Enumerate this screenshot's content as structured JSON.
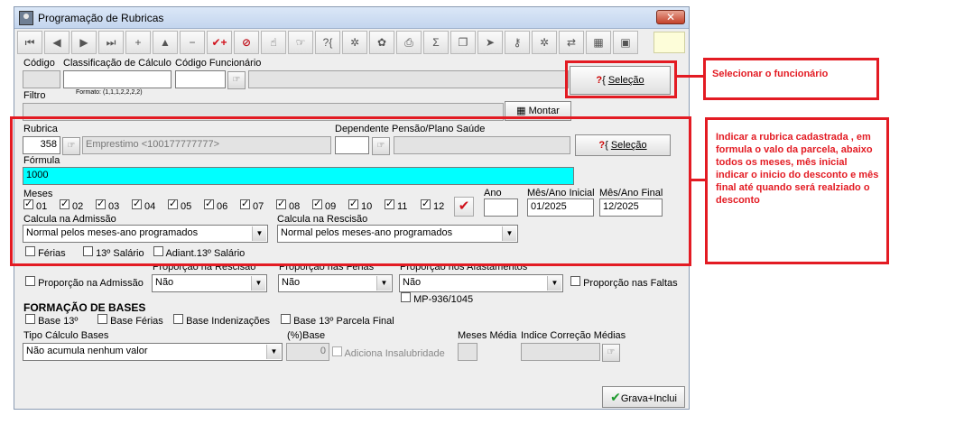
{
  "window": {
    "title": "Programação de Rubricas",
    "close_glyph": "✕"
  },
  "toolbar": {
    "buttons": [
      {
        "name": "first-record-icon",
        "glyph": "⏮"
      },
      {
        "name": "prev-record-icon",
        "glyph": "◀"
      },
      {
        "name": "next-record-icon",
        "glyph": "▶"
      },
      {
        "name": "last-record-icon",
        "glyph": "⏭"
      },
      {
        "name": "add-icon",
        "glyph": "+"
      },
      {
        "name": "edit-up-icon",
        "glyph": "▲"
      },
      {
        "name": "delete-icon",
        "glyph": "−"
      },
      {
        "name": "confirm-icon",
        "glyph": "✔+"
      },
      {
        "name": "cancel-icon",
        "glyph": "⊘"
      },
      {
        "name": "hand-icon",
        "glyph": "☝"
      },
      {
        "name": "select-icon",
        "glyph": "☞"
      },
      {
        "name": "query-icon",
        "glyph": "?{"
      },
      {
        "name": "tools-icon",
        "glyph": "✲"
      },
      {
        "name": "filter-icon",
        "glyph": "✿"
      },
      {
        "name": "print-icon",
        "glyph": "⎙"
      },
      {
        "name": "sum-icon",
        "glyph": "Σ"
      },
      {
        "name": "copy-icon",
        "glyph": "❐"
      },
      {
        "name": "export-icon",
        "glyph": "➤"
      },
      {
        "name": "key-icon",
        "glyph": "⚷"
      },
      {
        "name": "config-icon",
        "glyph": "✲"
      },
      {
        "name": "transfer-icon",
        "glyph": "⇄"
      },
      {
        "name": "calc-icon",
        "glyph": "▦"
      },
      {
        "name": "stop-icon",
        "glyph": "▣"
      }
    ]
  },
  "header": {
    "codigo_label": "Código",
    "classificacao_label": "Classificação de Cálculo",
    "classificacao_format": "Formato: (1,1,1,2,2,2,2)",
    "codigo_func_label": "Código Funcionário",
    "selecao_button": "Seleção",
    "filtro_label": "Filtro",
    "montar_button": "Montar"
  },
  "rubrica": {
    "label": "Rubrica",
    "code": "358",
    "description": "Emprestimo <100177777777>",
    "dependente_label": "Dependente Pensão/Plano Saúde",
    "selecao_button": "Seleção",
    "formula_label": "Fórmula",
    "formula_value": "1000"
  },
  "meses": {
    "label": "Meses",
    "months": [
      "01",
      "02",
      "03",
      "04",
      "05",
      "06",
      "07",
      "08",
      "09",
      "10",
      "11",
      "12"
    ],
    "ano_label": "Ano",
    "mes_ano_inicial_label": "Mês/Ano Inicial",
    "mes_ano_inicial_value": "01/2025",
    "mes_ano_final_label": "Mês/Ano Final",
    "mes_ano_final_value": "12/2025"
  },
  "calcula": {
    "admissao_label": "Calcula na Admissão",
    "admissao_value": "Normal pelos meses-ano programados",
    "rescisao_label": "Calcula na Rescisão",
    "rescisao_value": "Normal pelos meses-ano programados",
    "ferias_label": "Férias",
    "decimo_label": "13º Salário",
    "adiant_label": "Adiant.13º Salário"
  },
  "proporcao": {
    "admissao_label": "Proporção na Admissão",
    "rescisao_label": "Proporção na Rescisão",
    "rescisao_value": "Não",
    "ferias_label": "Proporção nas Férias",
    "ferias_value": "Não",
    "afastamentos_label": "Proporção nos Afastamentos",
    "afastamentos_value": "Não",
    "faltas_label": "Proporção nas Faltas",
    "mp_label": "MP-936/1045"
  },
  "bases": {
    "title": "FORMAÇÃO DE BASES",
    "base13_label": "Base 13º",
    "baseferias_label": "Base Férias",
    "baseindeniz_label": "Base Indenizações",
    "base13parcela_label": "Base 13º Parcela Final",
    "tipo_label": "Tipo Cálculo Bases",
    "tipo_value": "Não acumula nenhum valor",
    "pct_base_label": "(%)Base",
    "pct_base_value": "0",
    "insalubridade_label": "Adiciona Insalubridade",
    "meses_media_label": "Meses Média",
    "indice_label": "Indice Correção Médias"
  },
  "footer": {
    "grava_button": "Grava+Inclui"
  },
  "annotations": {
    "note1": "Selecionar o funcionário",
    "note2": "Indicar a rubrica cadastrada , em formula o valo da parcela, abaixo todos os meses, mês inicial indicar o inicio do desconto e mês final até quando será realziado o desconto"
  },
  "colors": {
    "annotation_red": "#e31b23",
    "formula_bg": "#00ffff",
    "confirm_check": "#d0111b",
    "save_check": "#1e9a2e"
  }
}
